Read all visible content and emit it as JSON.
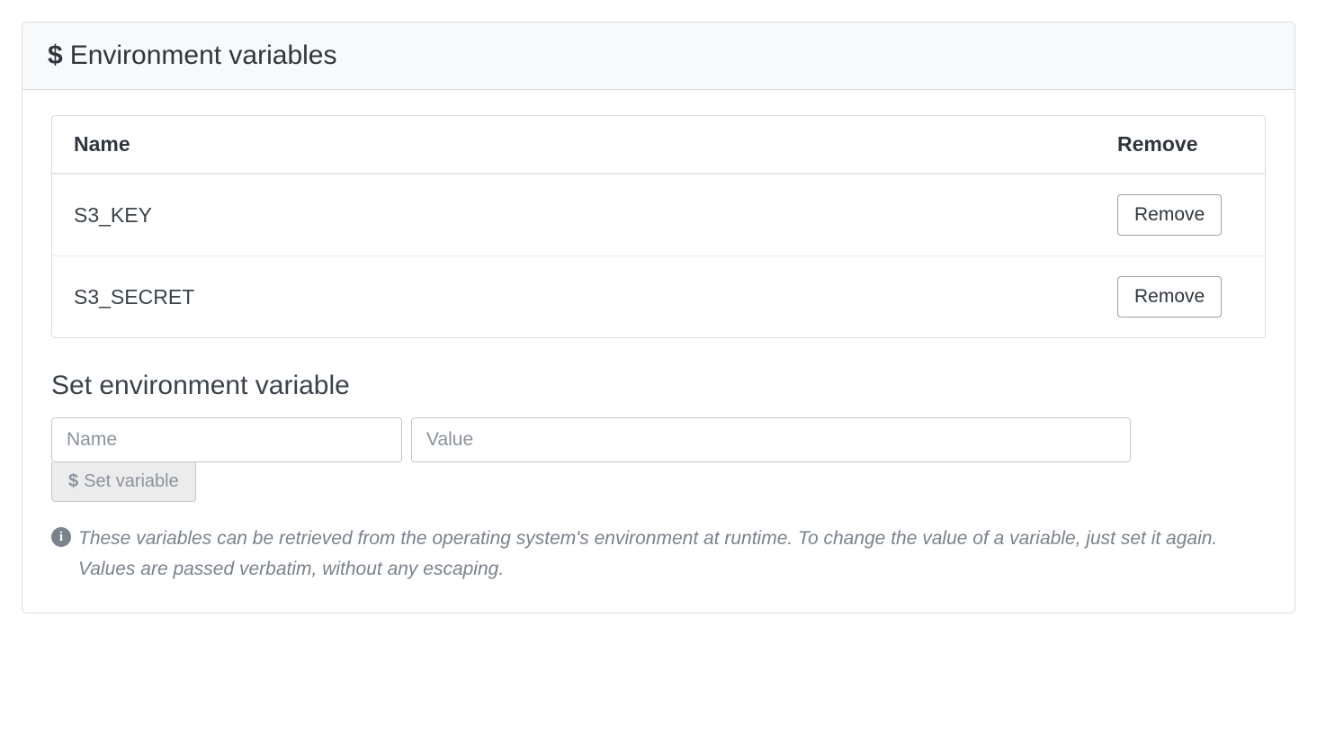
{
  "panel": {
    "title": "Environment variables"
  },
  "table": {
    "headers": {
      "name": "Name",
      "remove": "Remove"
    },
    "rows": [
      {
        "name": "S3_KEY",
        "remove_label": "Remove"
      },
      {
        "name": "S3_SECRET",
        "remove_label": "Remove"
      }
    ]
  },
  "set_form": {
    "heading": "Set environment variable",
    "name_placeholder": "Name",
    "value_placeholder": "Value",
    "button_label": "Set variable"
  },
  "help_text": "These variables can be retrieved from the operating system's environment at runtime. To change the value of a variable, just set it again. Values are passed verbatim, without any escaping."
}
